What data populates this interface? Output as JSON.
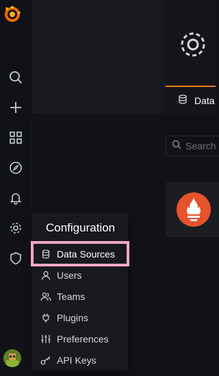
{
  "header": {
    "tab_label": "Data"
  },
  "search": {
    "placeholder": "Search"
  },
  "menu": {
    "title": "Configuration",
    "items": [
      {
        "label": "Data Sources",
        "icon": "database-icon",
        "active": true
      },
      {
        "label": "Users",
        "icon": "user-icon"
      },
      {
        "label": "Teams",
        "icon": "users-icon"
      },
      {
        "label": "Plugins",
        "icon": "plug-icon"
      },
      {
        "label": "Preferences",
        "icon": "sliders-icon"
      },
      {
        "label": "API Keys",
        "icon": "key-icon"
      }
    ]
  },
  "colors": {
    "accent": "#eb7b18",
    "highlight": "#f4a6c8",
    "prometheus": "#e6522c"
  }
}
